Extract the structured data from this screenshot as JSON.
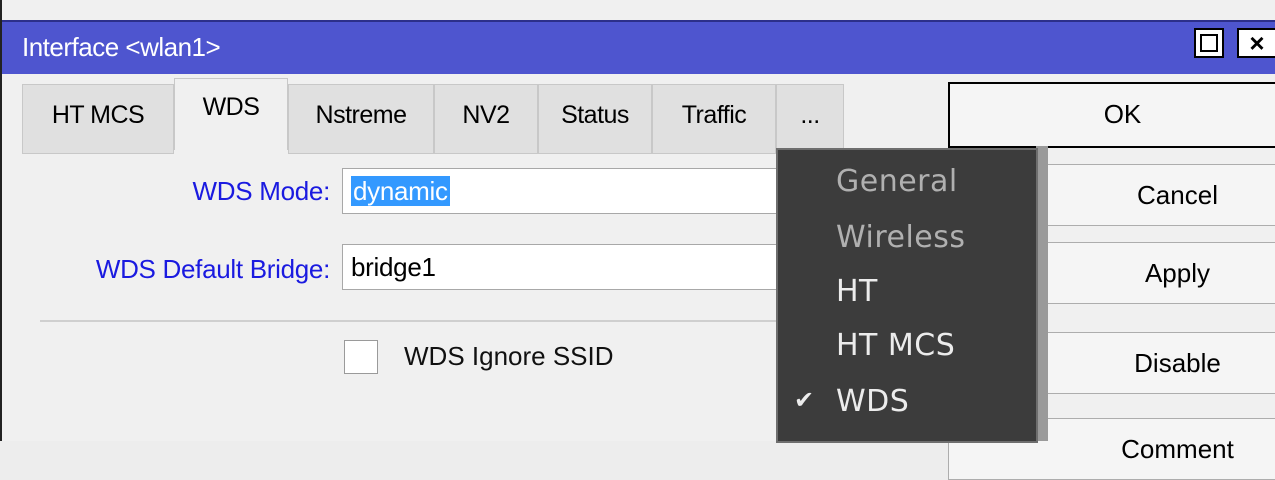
{
  "window": {
    "title": "Interface <wlan1>",
    "max_label": "",
    "close_label": "×"
  },
  "tabs": [
    {
      "label": "HT MCS"
    },
    {
      "label": "WDS"
    },
    {
      "label": "Nstreme"
    },
    {
      "label": "NV2"
    },
    {
      "label": "Status"
    },
    {
      "label": "Traffic"
    },
    {
      "label": "..."
    }
  ],
  "form": {
    "wds_mode_label": "WDS Mode:",
    "wds_mode_value": "dynamic",
    "wds_bridge_label": "WDS Default Bridge:",
    "wds_bridge_value": "bridge1",
    "ignore_ssid_label": "WDS Ignore SSID",
    "ignore_ssid_checked": false
  },
  "buttons": {
    "ok": "OK",
    "cancel": "Cancel",
    "apply": "Apply",
    "disable": "Disable",
    "comment": "Comment"
  },
  "menu": {
    "items": [
      {
        "label": "General",
        "checked": false
      },
      {
        "label": "Wireless",
        "checked": false
      },
      {
        "label": "HT",
        "checked": false
      },
      {
        "label": "HT MCS",
        "checked": false
      },
      {
        "label": "WDS",
        "checked": true
      }
    ],
    "check_glyph": "✔"
  },
  "colors": {
    "titlebar": "#4e55cf",
    "label_blue": "#1a1ae0",
    "selection": "#3399ff",
    "menu_bg": "#3c3c3c"
  }
}
